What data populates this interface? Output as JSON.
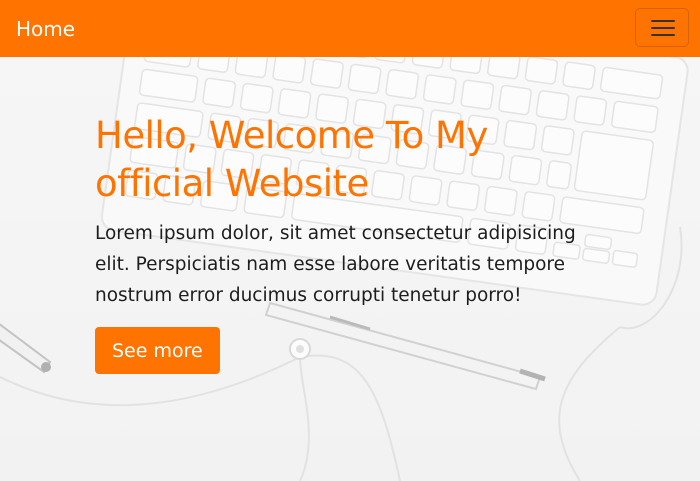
{
  "navbar": {
    "brand": "Home",
    "toggle_icon": "hamburger-menu-icon",
    "color": "#ff7300"
  },
  "hero": {
    "title": "Hello, Welcome To My official Website",
    "text": "Lorem ipsum dolor, sit amet consectetur adipisicing elit. Perspiciatis nam esse labore veritatis tempore nostrum error ducimus corrupti tenetur porro!",
    "button_label": "See more",
    "accent_color": "#ff7300"
  },
  "background": {
    "illustration": "keyboard-pen-earphones-photo"
  }
}
